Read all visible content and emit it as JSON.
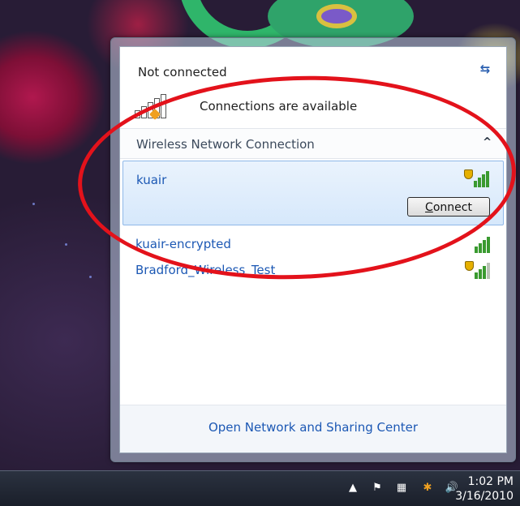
{
  "flyout": {
    "status_title": "Not connected",
    "availability": "Connections are available",
    "section_label": "Wireless Network Connection",
    "networks": [
      {
        "name": "kuair",
        "secured": true,
        "signal": 4,
        "selected": true
      },
      {
        "name": "kuair-encrypted",
        "secured": false,
        "signal": 4,
        "selected": false
      },
      {
        "name": "Bradford_Wireless_Test",
        "secured": true,
        "signal": 3,
        "selected": false
      }
    ],
    "connect_button": {
      "prefix": "C",
      "rest": "onnect"
    },
    "footer_link": "Open Network and Sharing Center"
  },
  "taskbar": {
    "time": "1:02 PM",
    "date": "3/16/2010"
  },
  "annotation": {
    "color": "#e3121b"
  }
}
